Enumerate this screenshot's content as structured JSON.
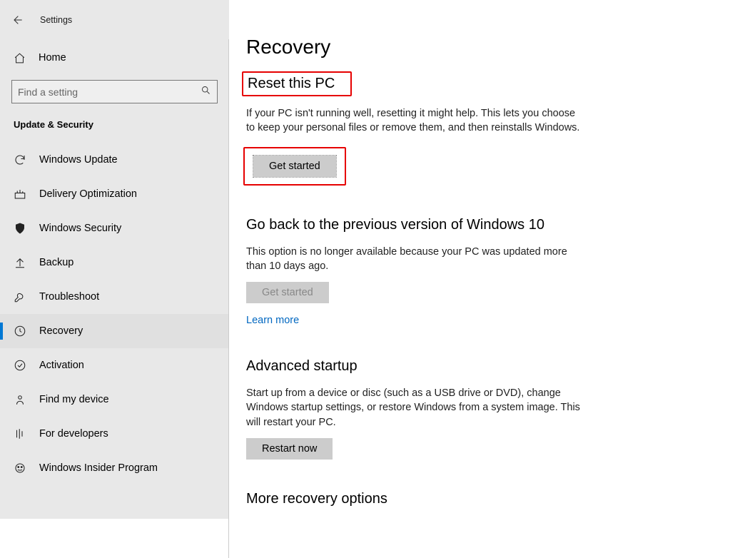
{
  "header": {
    "app_label": "Settings"
  },
  "sidebar": {
    "home_label": "Home",
    "search_placeholder": "Find a setting",
    "category": "Update & Security",
    "items": [
      {
        "icon": "refresh-icon",
        "label": "Windows Update"
      },
      {
        "icon": "delivery-icon",
        "label": "Delivery Optimization"
      },
      {
        "icon": "shield-icon",
        "label": "Windows Security"
      },
      {
        "icon": "backup-icon",
        "label": "Backup"
      },
      {
        "icon": "troubleshoot-icon",
        "label": "Troubleshoot"
      },
      {
        "icon": "recovery-icon",
        "label": "Recovery"
      },
      {
        "icon": "activation-icon",
        "label": "Activation"
      },
      {
        "icon": "find-device-icon",
        "label": "Find my device"
      },
      {
        "icon": "developers-icon",
        "label": "For developers"
      },
      {
        "icon": "insider-icon",
        "label": "Windows Insider Program"
      }
    ],
    "selected_index": 5
  },
  "main": {
    "title": "Recovery",
    "sections": {
      "reset": {
        "heading": "Reset this PC",
        "body": "If your PC isn't running well, resetting it might help. This lets you choose to keep your personal files or remove them, and then reinstalls Windows.",
        "button": "Get started"
      },
      "goback": {
        "heading": "Go back to the previous version of Windows 10",
        "body": "This option is no longer available because your PC was updated more than 10 days ago.",
        "button": "Get started",
        "link": "Learn more"
      },
      "advanced": {
        "heading": "Advanced startup",
        "body": "Start up from a device or disc (such as a USB drive or DVD), change Windows startup settings, or restore Windows from a system image. This will restart your PC.",
        "button": "Restart now"
      },
      "more": {
        "heading": "More recovery options"
      }
    }
  }
}
